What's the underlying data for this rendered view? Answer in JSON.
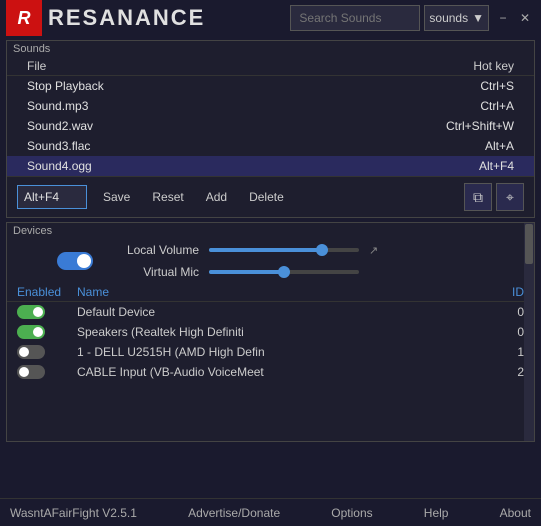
{
  "titlebar": {
    "logo_letter": "R",
    "logo_name": "RESANANCE",
    "search_placeholder": "Search Sounds",
    "dropdown_label": "sounds",
    "minimize_label": "−",
    "close_label": "✕"
  },
  "sounds": {
    "section_label": "Sounds",
    "col_file": "File",
    "col_hotkey": "Hot key",
    "rows": [
      {
        "file": "Stop Playback",
        "hotkey": "Ctrl+S"
      },
      {
        "file": "Sound.mp3",
        "hotkey": "Ctrl+A"
      },
      {
        "file": "Sound2.wav",
        "hotkey": "Ctrl+Shift+W"
      },
      {
        "file": "Sound3.flac",
        "hotkey": "Alt+A"
      },
      {
        "file": "Sound4.ogg",
        "hotkey": "Alt+F4"
      }
    ],
    "hotkey_value": "Alt+F4",
    "btn_save": "Save",
    "btn_reset": "Reset",
    "btn_add": "Add",
    "btn_delete": "Delete"
  },
  "devices": {
    "section_label": "Devices",
    "local_volume_label": "Local Volume",
    "virtual_mic_label": "Virtual Mic",
    "local_volume_pct": 75,
    "virtual_mic_pct": 50,
    "col_enabled": "Enabled",
    "col_name": "Name",
    "col_id": "ID",
    "rows": [
      {
        "enabled": true,
        "name": "Default Device",
        "id": "0"
      },
      {
        "enabled": true,
        "name": "Speakers (Realtek High Definiti",
        "id": "0"
      },
      {
        "enabled": false,
        "name": "1 - DELL U2515H (AMD High Defin",
        "id": "1"
      },
      {
        "enabled": false,
        "name": "CABLE Input (VB-Audio VoiceMeet",
        "id": "2"
      }
    ]
  },
  "statusbar": {
    "version": "WasntAFairFight V2.5.1",
    "advertise": "Advertise/Donate",
    "options": "Options",
    "help": "Help",
    "about": "About"
  }
}
